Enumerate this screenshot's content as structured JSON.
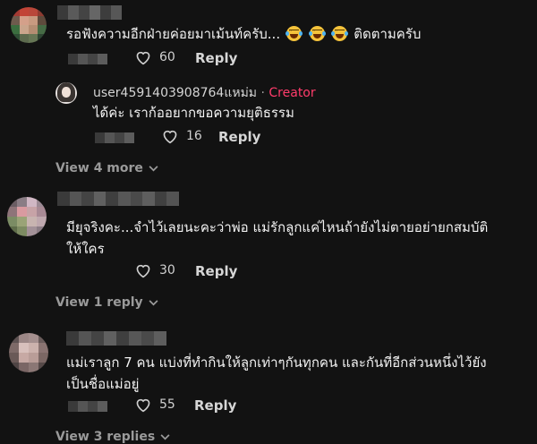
{
  "comments": [
    {
      "text_lines": [
        "รอฟังความอีกฝ่ายค่อยมาเม้นท์ครับ...",
        "ติดตามครับ"
      ],
      "emoji_icon": "tears-of-joy-emoji",
      "likes": "60",
      "reply_label": "Reply",
      "replies": [
        {
          "username": "user4591403908764แหม่ม",
          "separator": "·",
          "badge": "Creator",
          "text": "ได้ค่ะ เราก้ออยากขอความยุติธรรม",
          "likes": "16",
          "reply_label": "Reply"
        }
      ],
      "view_more_label": "View 4 more"
    },
    {
      "text_lines": [
        "มียุจริงคะ...จำไว้เลยนะคะว่าพ่อ แม่รักลูกแค่ไหนถ้ายังไม่ตายอย่ายกสมบัติ",
        "ให้ใคร"
      ],
      "likes": "30",
      "reply_label": "Reply",
      "view_more_label": "View 1 reply"
    },
    {
      "text_lines": [
        "แม่เราลูก 7 คน แบ่งที่ทำกินให้ลูกเท่าๆกันทุกคน และกันที่อีกส่วนหนึ่งไว้ยัง",
        "เป็นชื่อแม่อยู่"
      ],
      "likes": "55",
      "reply_label": "Reply",
      "view_more_label": "View 3 replies"
    }
  ],
  "colors": {
    "background": "#121212",
    "creator_badge": "#ff3c6b",
    "muted_text": "#9a9a9a"
  },
  "icons": [
    "heart-outline-icon",
    "chevron-down-icon"
  ]
}
